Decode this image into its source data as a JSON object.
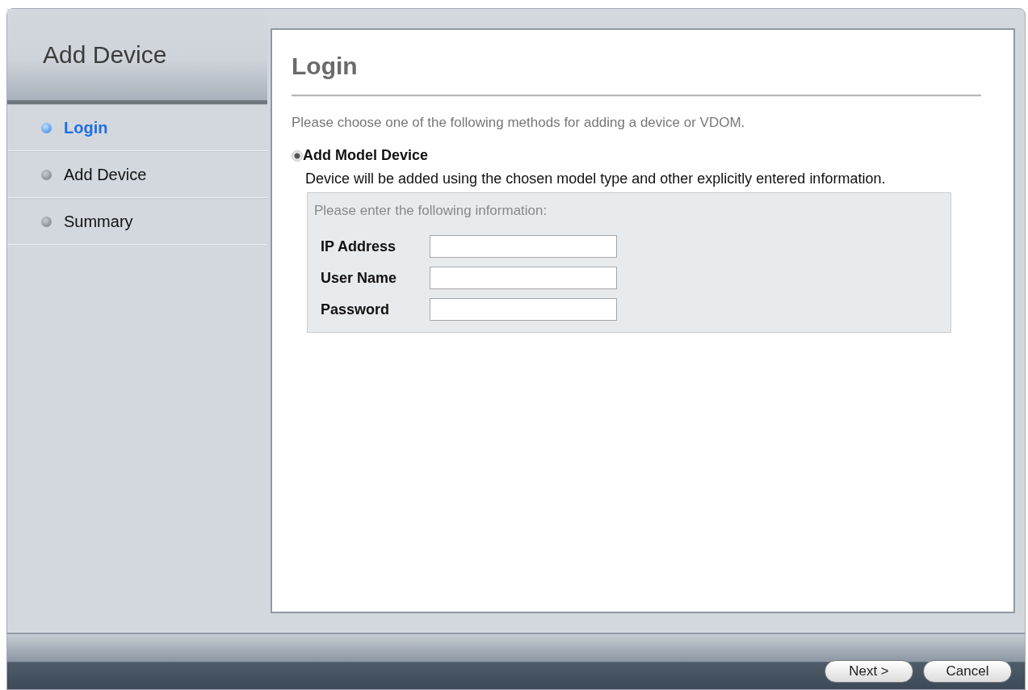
{
  "wizard": {
    "title": "Add Device"
  },
  "steps": [
    {
      "label": "Login",
      "selected": true
    },
    {
      "label": "Add Device",
      "selected": false
    },
    {
      "label": "Summary",
      "selected": false
    }
  ],
  "panel": {
    "heading": "Login",
    "intro": "Please choose one of the following methods for adding a device or VDOM.",
    "option": {
      "label": "Add Model Device",
      "selected": true,
      "description": "Device will be added using the chosen model type and other explicitly entered information."
    },
    "form": {
      "prompt": "Please enter the following information:",
      "fields": [
        {
          "label": "IP Address"
        },
        {
          "label": "User Name"
        },
        {
          "label": "Password"
        }
      ]
    }
  },
  "buttons": [
    "Next >",
    "Cancel"
  ]
}
